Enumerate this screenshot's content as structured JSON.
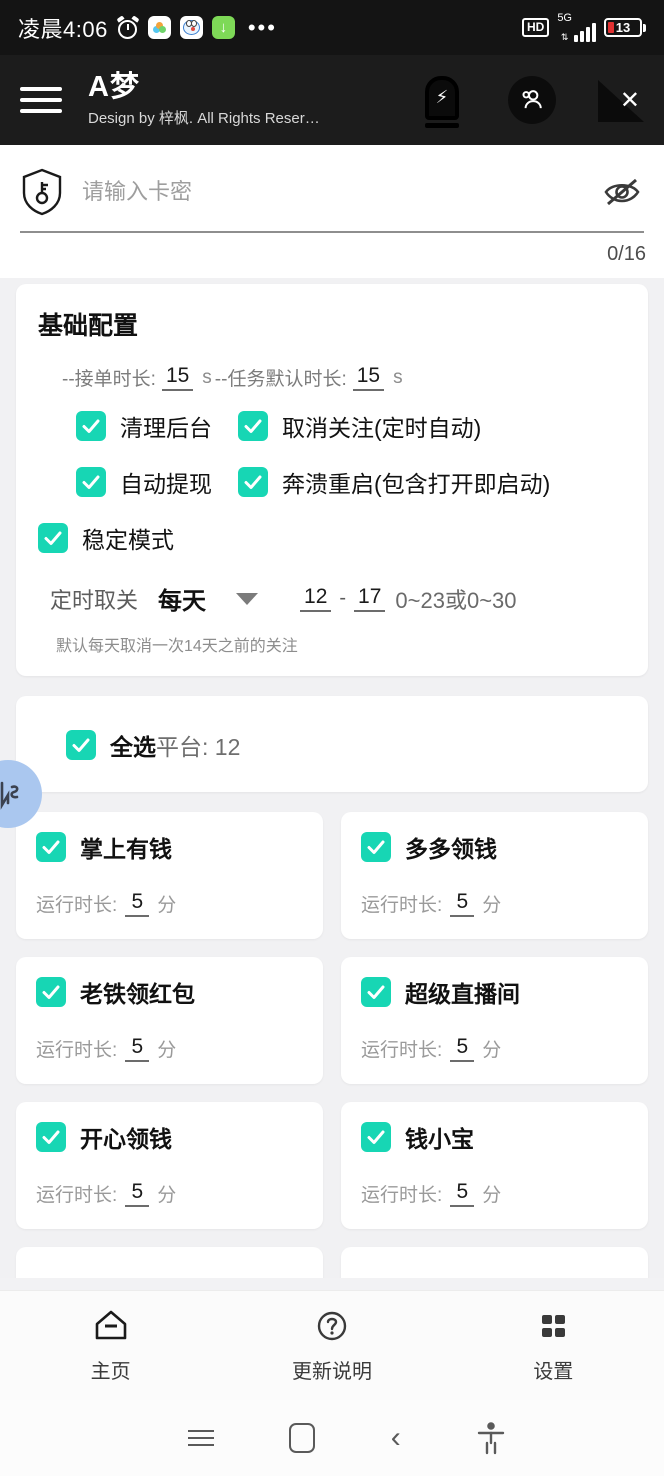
{
  "statusbar": {
    "time": "凌晨4:06",
    "alarm_icon": "alarm-icon",
    "app_icons": [
      "cloud-icon",
      "doraemon-icon",
      "download-icon"
    ],
    "overflow": "•••",
    "hd": "HD",
    "network": "5G",
    "battery_percent": "13"
  },
  "appbar": {
    "menu_icon": "hamburger-icon",
    "title": "A梦",
    "subtitle": "Design by 梓枫. All Rights Reser…",
    "icons": [
      "battery-boost-icon",
      "account-icon",
      "no-signal-icon"
    ]
  },
  "card_input": {
    "lock_icon": "shield-key-icon",
    "placeholder": "请输入卡密",
    "value": "",
    "eye_icon": "eye-off-icon",
    "counter": "0/16"
  },
  "basic_config": {
    "title": "基础配置",
    "duration_prefix": "--接单时长:",
    "order_duration": "15",
    "order_unit": "s",
    "duration_mid": "--任务默认时长:",
    "task_duration": "15",
    "task_unit": "s",
    "checkboxes": [
      {
        "label": "清理后台",
        "checked": true
      },
      {
        "label": "取消关注(定时自动)",
        "checked": true
      },
      {
        "label": "自动提现",
        "checked": true
      },
      {
        "label": "奔溃重启(包含打开即启动)",
        "checked": true
      },
      {
        "label": "稳定模式",
        "checked": true
      }
    ],
    "schedule": {
      "label": "定时取关",
      "value": "每天",
      "caret_icon": "chevron-down-icon",
      "hour_start": "12",
      "separator": "-",
      "hour_end": "17",
      "range_hint": "0~23或0~30",
      "note": "默认每天取消一次14天之前的关注"
    }
  },
  "platforms": {
    "select_all_strong": "全选",
    "select_all_rest": "平台: 12",
    "select_all_checked": true,
    "duration_label": "运行时长:",
    "duration_unit": "分",
    "items": [
      {
        "name": "掌上有钱",
        "checked": true,
        "duration": "5"
      },
      {
        "name": "多多领钱",
        "checked": true,
        "duration": "5"
      },
      {
        "name": "老铁领红包",
        "checked": true,
        "duration": "5"
      },
      {
        "name": "超级直播间",
        "checked": true,
        "duration": "5"
      },
      {
        "name": "开心领钱",
        "checked": true,
        "duration": "5"
      },
      {
        "name": "钱小宝",
        "checked": true,
        "duration": "5"
      }
    ]
  },
  "float_widget": {
    "icon": "assistant-logo-icon",
    "color": "#aac7ef"
  },
  "bottom_nav": [
    {
      "label": "主页",
      "icon": "home-icon",
      "active": true
    },
    {
      "label": "更新说明",
      "icon": "help-circle-icon",
      "active": false
    },
    {
      "label": "设置",
      "icon": "grid-settings-icon",
      "active": false
    }
  ],
  "system_nav": [
    "recents-icon",
    "home-icon",
    "back-icon",
    "accessibility-icon"
  ],
  "colors": {
    "accent": "#17d6b4",
    "appbar_bg": "#1c1c1c",
    "statusbar_bg": "#141414",
    "page_bg": "#f1f1f3",
    "battery_low": "#e03131"
  }
}
